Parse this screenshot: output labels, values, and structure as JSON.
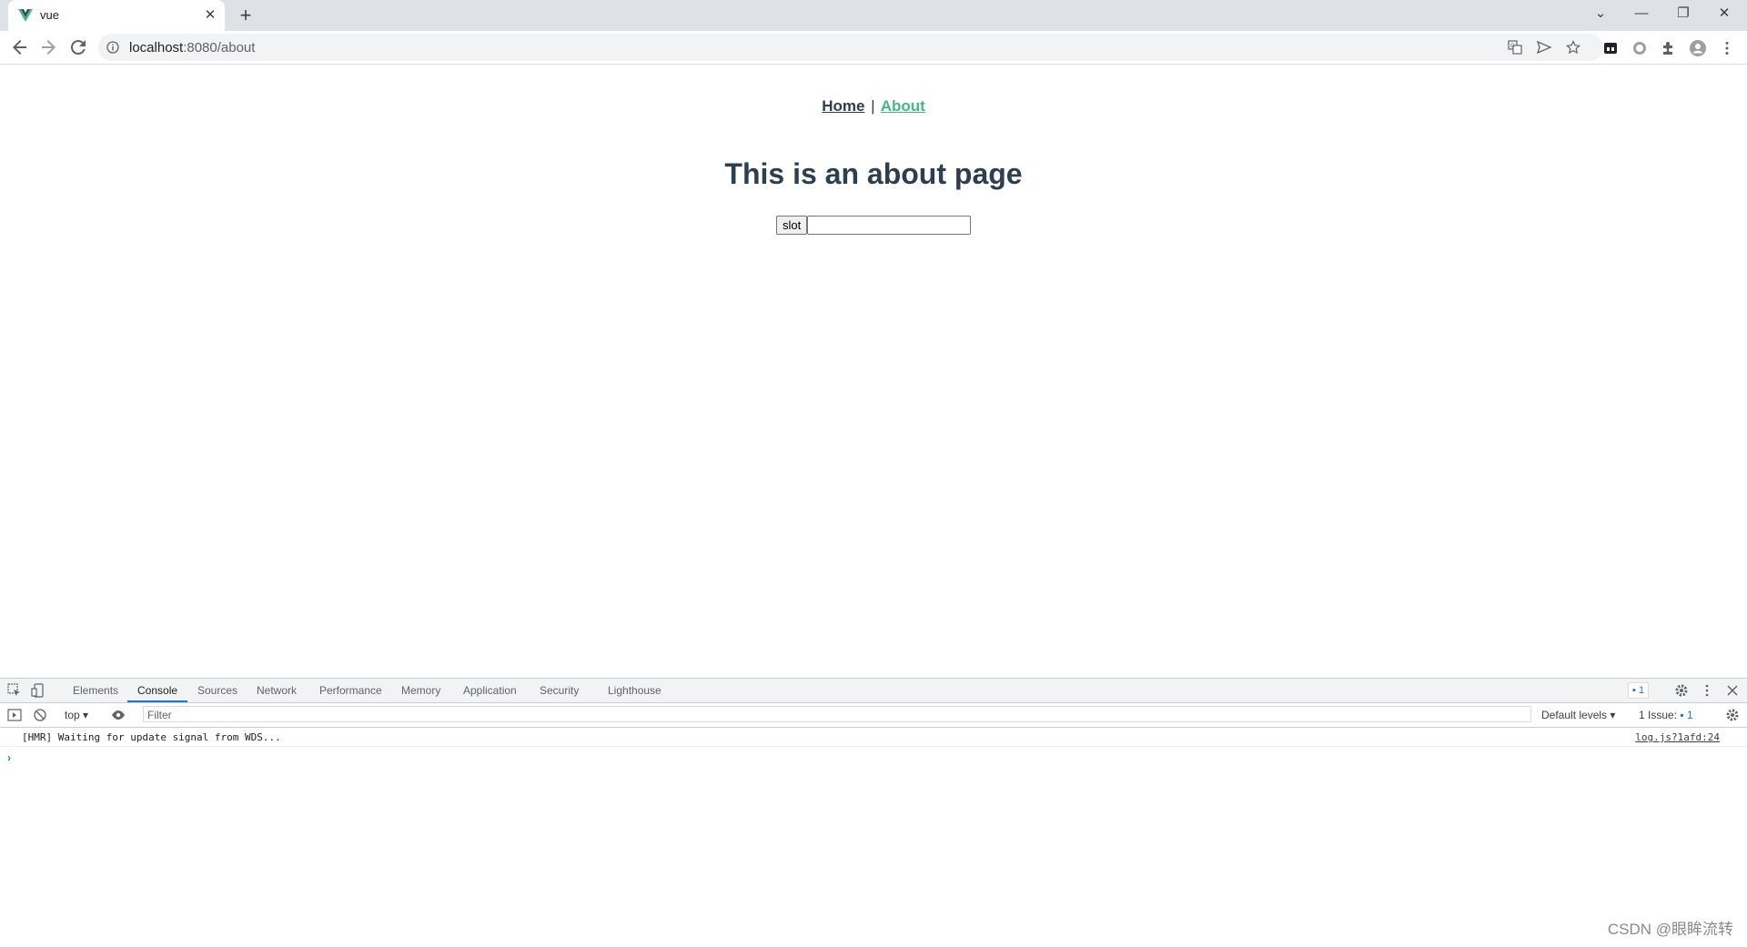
{
  "browser": {
    "tab_title": "vue",
    "url_host": "localhost",
    "url_rest": ":8080/about"
  },
  "page": {
    "nav_home": "Home",
    "nav_separator": "|",
    "nav_about": "About",
    "heading": "This is an about page",
    "slot_button": "slot",
    "input_value": "",
    "colors": {
      "text": "#2c3e50",
      "active_link": "#42b983"
    }
  },
  "devtools": {
    "tabs": [
      "Elements",
      "Console",
      "Sources",
      "Network",
      "Performance",
      "Memory",
      "Application",
      "Security",
      "Lighthouse"
    ],
    "active_tab": "Console",
    "message_badge": "1",
    "context": "top",
    "filter_placeholder": "Filter",
    "levels": "Default levels",
    "issues": "1 Issue:",
    "issues_count": "1",
    "console_message": "[HMR] Waiting for update signal from WDS...",
    "console_source": "log.js?1afd:24",
    "prompt": "›"
  },
  "watermark": "CSDN @眼眸流转"
}
